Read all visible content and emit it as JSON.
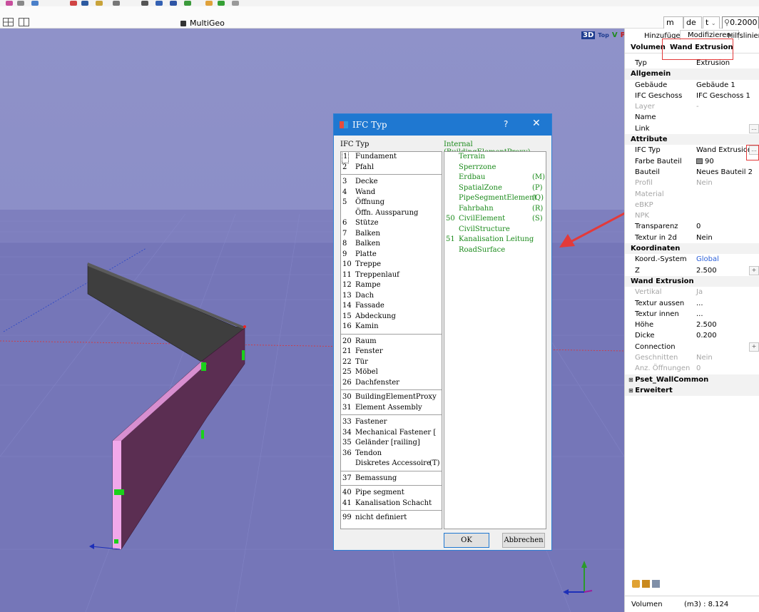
{
  "header": {
    "title": "MultiGeo",
    "dropdowns": [
      {
        "value": "m"
      },
      {
        "value": "de"
      },
      {
        "value": "t"
      }
    ],
    "number_value": "0.2000"
  },
  "viewport": {
    "view_buttons": [
      "3D",
      "Top",
      "V",
      "P"
    ]
  },
  "dialog": {
    "title": "IFC Typ",
    "help": "?",
    "close": "✕",
    "left_label": "IFC Typ",
    "right_label": "Internal (BuildingElementProxy)",
    "groups": [
      [
        {
          "num": "1",
          "text": "Fundament"
        },
        {
          "num": "2",
          "text": "Pfahl"
        }
      ],
      [
        {
          "num": "3",
          "text": "Decke"
        },
        {
          "num": "4",
          "text": "Wand"
        },
        {
          "num": "5",
          "text": "Öffnung"
        },
        {
          "num": "",
          "text": "Öffn. Aussparung"
        },
        {
          "num": "6",
          "text": "Stütze"
        },
        {
          "num": "7",
          "text": "Balken"
        },
        {
          "num": "8",
          "text": "Balken"
        },
        {
          "num": "9",
          "text": "Platte"
        },
        {
          "num": "10",
          "text": "Treppe"
        },
        {
          "num": "11",
          "text": "Treppenlauf"
        },
        {
          "num": "12",
          "text": "Rampe"
        },
        {
          "num": "13",
          "text": "Dach"
        },
        {
          "num": "14",
          "text": "Fassade"
        },
        {
          "num": "15",
          "text": "Abdeckung"
        },
        {
          "num": "16",
          "text": "Kamin"
        }
      ],
      [
        {
          "num": "20",
          "text": "Raum"
        },
        {
          "num": "21",
          "text": "Fenster"
        },
        {
          "num": "22",
          "text": "Tür"
        },
        {
          "num": "25",
          "text": "Möbel"
        },
        {
          "num": "26",
          "text": "Dachfenster"
        }
      ],
      [
        {
          "num": "30",
          "text": "BuildingElementProxy"
        },
        {
          "num": "31",
          "text": "Element Assembly"
        }
      ],
      [
        {
          "num": "33",
          "text": "Fastener"
        },
        {
          "num": "34",
          "text": "Mechanical Fastener ["
        },
        {
          "num": "35",
          "text": "Geländer  [railing]"
        },
        {
          "num": "36",
          "text": "Tendon"
        },
        {
          "num": "",
          "text": "Diskretes Accessoire",
          "suffix": "(T)"
        }
      ],
      [
        {
          "num": "37",
          "text": "Bemassung"
        }
      ],
      [
        {
          "num": "40",
          "text": "Pipe segment"
        },
        {
          "num": "41",
          "text": "Kanalisation Schacht"
        }
      ],
      [
        {
          "num": "99",
          "text": "nicht definiert"
        }
      ]
    ],
    "internal_items": [
      {
        "num": "",
        "text": "Terrain",
        "suffix": ""
      },
      {
        "num": "",
        "text": "Sperrzone",
        "suffix": ""
      },
      {
        "num": "",
        "text": "Erdbau",
        "suffix": "(M)"
      },
      {
        "num": "",
        "text": "SpatialZone",
        "suffix": "(P)"
      },
      {
        "num": "",
        "text": "PipeSegmentElement",
        "suffix": "(Q)"
      },
      {
        "num": "",
        "text": "Fahrbahn",
        "suffix": "(R)"
      },
      {
        "num": "50",
        "text": "CivilElement",
        "suffix": "(S)"
      },
      {
        "num": "",
        "text": "CivilStructure",
        "suffix": ""
      },
      {
        "num": "51",
        "text": "Kanalisation Leitung",
        "suffix": ""
      },
      {
        "num": "",
        "text": "RoadSurface",
        "suffix": ""
      }
    ],
    "ok_label": "OK",
    "cancel_label": "Abbrechen"
  },
  "panel": {
    "tabs": [
      "Hinzufügen",
      "Modifizieren",
      "Hilfslinien"
    ],
    "subtabs": [
      "Volumen",
      "Wand Extrusion"
    ],
    "rows": [
      {
        "key": "Typ",
        "value": "Extrusion"
      },
      {
        "section": "Allgemein"
      },
      {
        "key": "Gebäude",
        "value": "Gebäude 1"
      },
      {
        "key": "IFC Geschoss",
        "value": "IFC Geschoss  1"
      },
      {
        "key": "Layer",
        "value": "-",
        "grey": true
      },
      {
        "key": "Name",
        "value": ""
      },
      {
        "key": "Link",
        "value": "",
        "button": "..."
      },
      {
        "section": "Attribute"
      },
      {
        "key": "IFC Typ",
        "value": "Wand Extrusion",
        "button": "..."
      },
      {
        "key": "Farbe Bauteil",
        "value": "90",
        "swatch": true
      },
      {
        "key": "Bauteil",
        "value": "Neues Bauteil 2"
      },
      {
        "key": "Profil",
        "value": "Nein",
        "grey": true
      },
      {
        "key": "Material",
        "value": "",
        "grey": true
      },
      {
        "key": "eBKP",
        "value": "",
        "grey": true
      },
      {
        "key": "NPK",
        "value": "",
        "grey": true
      },
      {
        "key": "Transparenz",
        "value": "0"
      },
      {
        "key": "Textur in 2d",
        "value": "Nein"
      },
      {
        "section": "Koordinaten"
      },
      {
        "key": "Koord.-System",
        "value": "Global",
        "blue": true
      },
      {
        "key": "Z",
        "value": "2.500",
        "button": "+"
      },
      {
        "section": "Wand Extrusion"
      },
      {
        "key": "Vertikal",
        "value": "Ja",
        "grey": true
      },
      {
        "key": "Textur aussen",
        "value": "..."
      },
      {
        "key": "Textur innen",
        "value": "..."
      },
      {
        "key": "Höhe",
        "value": "2.500"
      },
      {
        "key": "Dicke",
        "value": "0.200"
      },
      {
        "key": "Connection",
        "value": "",
        "button": "+"
      },
      {
        "key": "Geschnitten",
        "value": "Nein",
        "grey": true
      },
      {
        "key": "Anz. Öffnungen",
        "value": "0",
        "grey": true
      },
      {
        "expand": "Pset_WallCommon"
      },
      {
        "expand": "Erweitert"
      }
    ],
    "volume_label": "Volumen",
    "volume_value": "(m3) : 8.124"
  },
  "colors": {
    "accent": "#1f78d1",
    "annotation": "#e33a3a",
    "ifc_green": "#1a8a1a",
    "wall": "#5b2e52",
    "wall_top": "#3f3f3f"
  }
}
